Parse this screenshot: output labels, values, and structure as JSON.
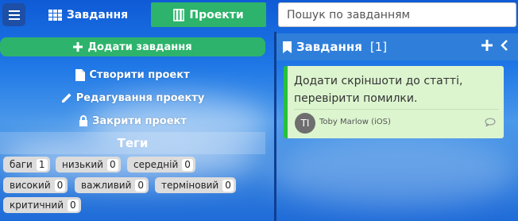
{
  "topbar": {
    "tab_tasks": "Завдання",
    "tab_projects": "Проекти",
    "search_placeholder": "Пошук по завданням"
  },
  "left": {
    "add_task": "Додати завдання",
    "create_project": "Створити проект",
    "edit_project": "Редагування проекту",
    "close_project": "Закрити проект",
    "tags_title": "Теги",
    "tags": [
      {
        "name": "баги",
        "count": "1"
      },
      {
        "name": "низький",
        "count": "0"
      },
      {
        "name": "середній",
        "count": "0"
      },
      {
        "name": "високий",
        "count": "0"
      },
      {
        "name": "важливий",
        "count": "0"
      },
      {
        "name": "терміновий",
        "count": "0"
      },
      {
        "name": "критичний",
        "count": "0"
      }
    ]
  },
  "column": {
    "title": "Завдання",
    "count": "[1]"
  },
  "card": {
    "text": "Додати скріншоти до статті, перевірити помилки.",
    "avatar": "TI",
    "assignee": "Toby Marlow (iOS)"
  },
  "colors": {
    "green": "#2db36b",
    "card_bg": "#dcf5cf",
    "card_accent": "#26c13a",
    "header_blue": "#2f7fda"
  }
}
